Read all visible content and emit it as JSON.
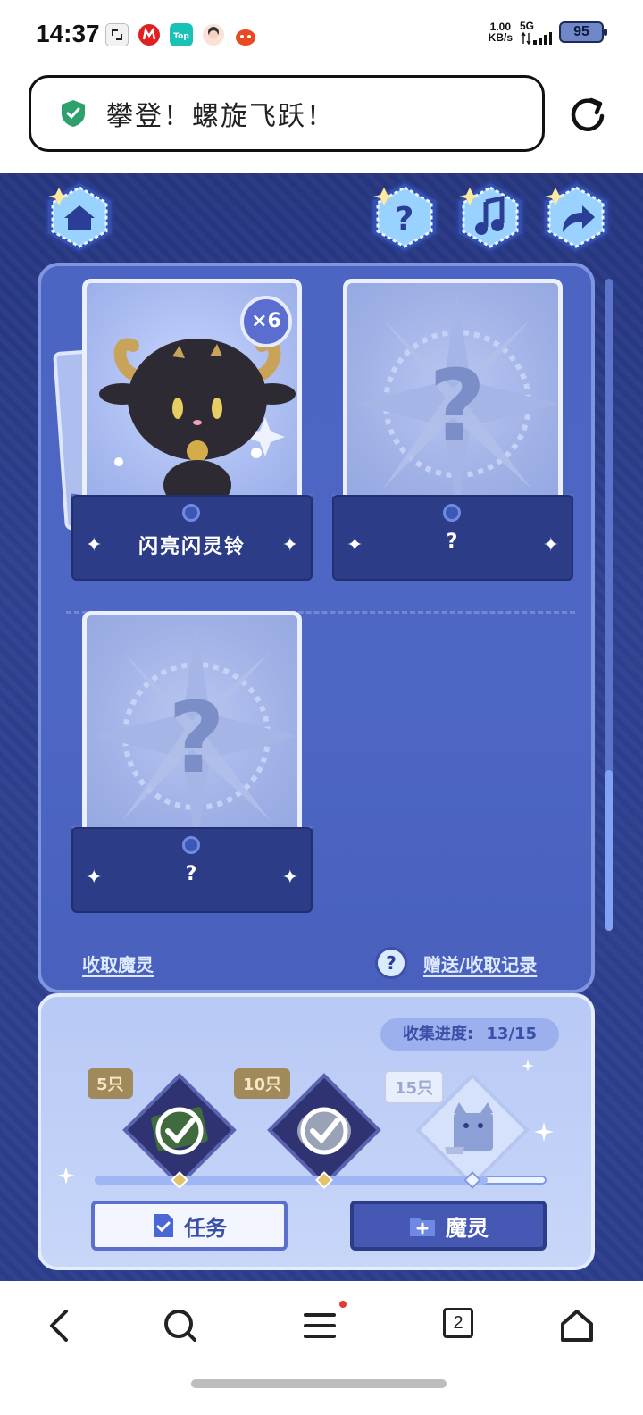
{
  "status": {
    "time": "14:37",
    "net_speed_value": "1.00",
    "net_speed_unit": "KB/s",
    "network": "5G",
    "battery": "95"
  },
  "titlebar": {
    "title": "攀登！螺旋飞跃！"
  },
  "cards": [
    {
      "name": "闪亮闪灵铃",
      "count": "×6",
      "state": "owned"
    },
    {
      "name": "?",
      "state": "locked"
    },
    {
      "name": "?",
      "state": "locked"
    }
  ],
  "links": {
    "collect": "收取魔灵",
    "records": "赠送/收取记录"
  },
  "progress": {
    "label": "收集进度:",
    "value": "13/15",
    "fraction": 0.87,
    "rewards": [
      {
        "tag": "5只",
        "claimed": true
      },
      {
        "tag": "10只",
        "claimed": true
      },
      {
        "tag": "15只",
        "claimed": false
      }
    ]
  },
  "buttons": {
    "task": "任务",
    "spirit": "魔灵"
  },
  "nav": {
    "tabs_count": "2"
  },
  "colors": {
    "accent": "#4558b3",
    "panel": "#4c64c2",
    "shield": "#2ea06b"
  }
}
